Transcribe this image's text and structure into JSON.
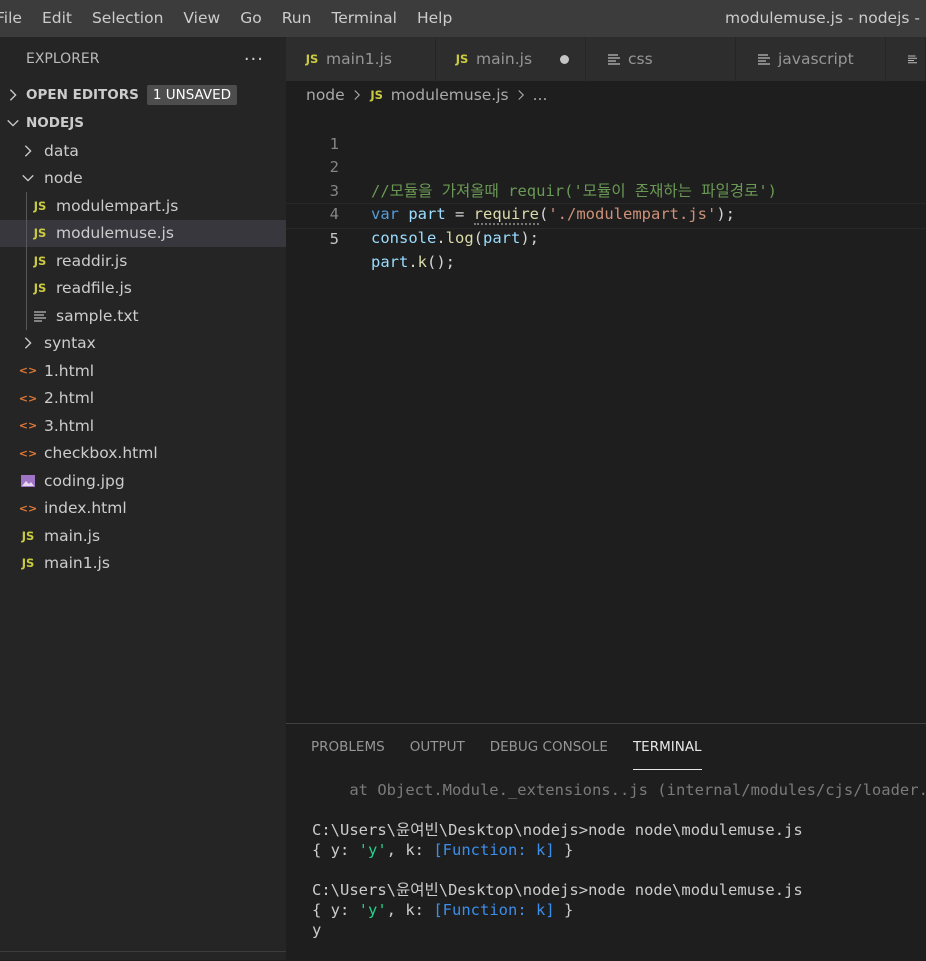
{
  "menu": [
    "File",
    "Edit",
    "Selection",
    "View",
    "Go",
    "Run",
    "Terminal",
    "Help"
  ],
  "window_title": "modulemuse.js - nodejs -",
  "explorer": {
    "title": "EXPLORER",
    "more": "···",
    "open_editors": "OPEN EDITORS",
    "unsaved_badge": "1 UNSAVED",
    "root": "NODEJS",
    "items": [
      {
        "label": "data",
        "type": "folder",
        "depth": 1
      },
      {
        "label": "node",
        "type": "folder-open",
        "depth": 1
      },
      {
        "label": "modulempart.js",
        "type": "js",
        "depth": 2
      },
      {
        "label": "modulemuse.js",
        "type": "js",
        "depth": 2,
        "selected": true
      },
      {
        "label": "readdir.js",
        "type": "js",
        "depth": 2
      },
      {
        "label": "readfile.js",
        "type": "js",
        "depth": 2
      },
      {
        "label": "sample.txt",
        "type": "txt",
        "depth": 2
      },
      {
        "label": "syntax",
        "type": "folder",
        "depth": 1
      },
      {
        "label": "1.html",
        "type": "html",
        "depth": 1
      },
      {
        "label": "2.html",
        "type": "html",
        "depth": 1
      },
      {
        "label": "3.html",
        "type": "html",
        "depth": 1
      },
      {
        "label": "checkbox.html",
        "type": "html",
        "depth": 1
      },
      {
        "label": "coding.jpg",
        "type": "image",
        "depth": 1
      },
      {
        "label": "index.html",
        "type": "html",
        "depth": 1
      },
      {
        "label": "main.js",
        "type": "js",
        "depth": 1
      },
      {
        "label": "main1.js",
        "type": "js",
        "depth": 1
      }
    ]
  },
  "tabs": [
    {
      "label": "main1.js",
      "icon": "js"
    },
    {
      "label": "main.js",
      "icon": "js",
      "dirty": true
    },
    {
      "label": "css",
      "icon": "lines"
    },
    {
      "label": "javascript",
      "icon": "lines"
    },
    {
      "label": "",
      "icon": "lines"
    }
  ],
  "breadcrumb": {
    "folder": "node",
    "file": "modulemuse.js",
    "more": "..."
  },
  "editor": {
    "line_numbers": [
      "1",
      "2",
      "3",
      "4",
      "5"
    ],
    "line2": "//모듈을 가져올때 requir('모듈이 존재하는 파일경로')",
    "line3": {
      "kw": "var",
      "name": "part",
      "eq": " = ",
      "fn": "require",
      "open": "(",
      "str": "'./modulempart.js'",
      "close": ");"
    },
    "line4": {
      "obj": "console",
      "dot": ".",
      "fn": "log",
      "open": "(",
      "arg": "part",
      "close": ");"
    },
    "line5": {
      "obj": "part",
      "dot": ".",
      "fn": "k",
      "rest": "();"
    }
  },
  "panel": {
    "tabs": [
      "PROBLEMS",
      "OUTPUT",
      "DEBUG CONSOLE",
      "TERMINAL"
    ],
    "active_tab": "TERMINAL"
  },
  "terminal": {
    "trace": "    at Object.Module._extensions..js (internal/modules/cjs/loader.js",
    "prompt1": "C:\\Users\\윤여빈\\Desktop\\nodejs>node node\\modulemuse.js",
    "obj_open": "{ y: ",
    "obj_y": "'y'",
    "obj_mid": ", k: ",
    "obj_fn": "[Function: k]",
    "obj_close": " }",
    "prompt2": "C:\\Users\\윤여빈\\Desktop\\nodejs>node node\\modulemuse.js",
    "output": "y"
  },
  "colors": {
    "accent_js": "#cbcb41",
    "accent_html": "#e37933",
    "comment": "#6a9955",
    "keyword": "#569cd6",
    "string": "#ce9178"
  }
}
